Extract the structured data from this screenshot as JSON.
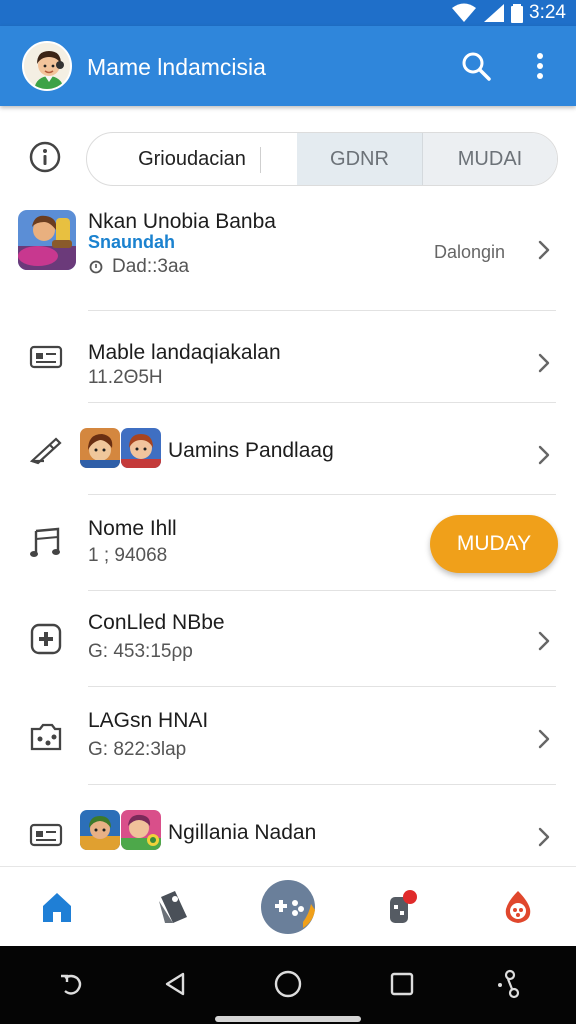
{
  "status_bar": {
    "time": "3:24"
  },
  "app_bar": {
    "title": "Mame lndamcisia"
  },
  "filter": {
    "segments": [
      "Grioudacian",
      "GDNR",
      "MUDAI"
    ]
  },
  "items": [
    {
      "title": "Nkan Unobia Banba",
      "subtitle_accent": "Snaundah",
      "subtitle": "Dad::3aa",
      "meta": "Dalongin"
    },
    {
      "title": "Mable landaqiakalan",
      "subtitle": "11.2Θ5Η"
    },
    {
      "title": "Uamins Pandlaag"
    },
    {
      "title": "Nome Ihll",
      "subtitle": "1 ; 94068",
      "action_label": "MUDAY"
    },
    {
      "title": "ConLled NBbe",
      "subtitle": "G: 453:15ρp"
    },
    {
      "title": "LAGsn HNAI",
      "subtitle": "G: 822:3lap"
    },
    {
      "title": "Ngillania Nadan"
    }
  ],
  "icons": {
    "status": [
      "wifi-icon",
      "signal-icon",
      "battery-icon"
    ],
    "app_bar": [
      "avatar",
      "search-icon",
      "more-vert-icon"
    ],
    "rows": [
      "game-thumbnail",
      "id-card-icon",
      "edit-pen-icon",
      "music-note-icon",
      "gamepad-icon",
      "camera-icon",
      "id-card-icon"
    ],
    "bottom_nav": [
      "home-icon",
      "tag-icon",
      "gamepad-fab-icon",
      "notification-icon",
      "fire-icon"
    ],
    "system_nav": [
      "rotate-icon",
      "back-icon",
      "home-circle-icon",
      "recents-icon",
      "accessibility-icon"
    ]
  },
  "colors": {
    "app_bar": "#2f86db",
    "status_bar": "#1f6fc9",
    "accent_orange": "#f0a01a",
    "accent_text": "#1b82cf",
    "home_active": "#1f7fd6"
  }
}
